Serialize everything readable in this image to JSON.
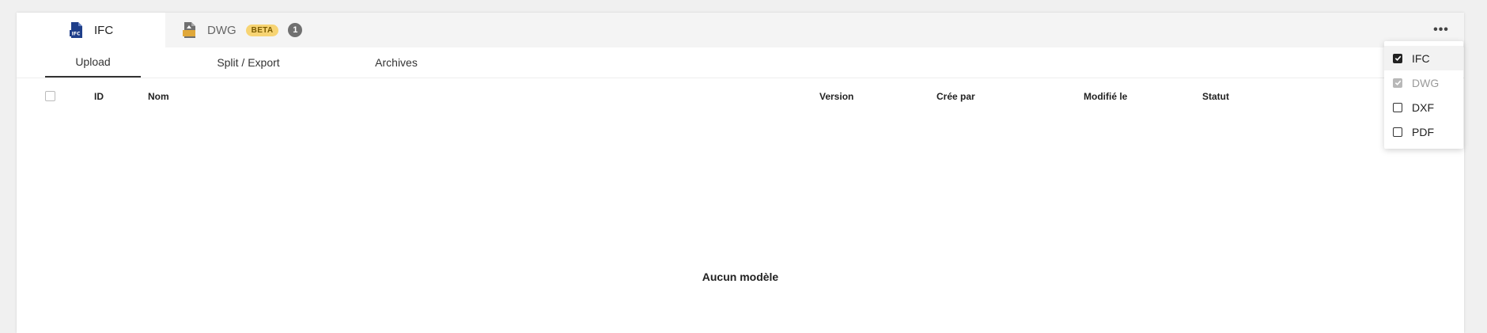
{
  "file_tabs": [
    {
      "label": "IFC",
      "icon": "ifc-file-icon",
      "icon_text": "IFC",
      "active": true
    },
    {
      "label": "DWG",
      "icon": "dwg-file-icon",
      "badge": "BETA",
      "count": "1",
      "active": false
    }
  ],
  "more_menu": {
    "icon": "more-horizontal-icon",
    "label": "•••"
  },
  "subtabs": [
    {
      "label": "Upload",
      "active": true
    },
    {
      "label": "Split / Export",
      "active": false
    },
    {
      "label": "Archives",
      "active": false
    }
  ],
  "table": {
    "columns": {
      "id": "ID",
      "name": "Nom",
      "version": "Version",
      "created_by": "Crée par",
      "modified": "Modifié le",
      "status": "Statut"
    },
    "empty_message": "Aucun modèle"
  },
  "format_menu": {
    "items": [
      {
        "label": "IFC",
        "checked": true,
        "disabled": false
      },
      {
        "label": "DWG",
        "checked": true,
        "disabled": true
      },
      {
        "label": "DXF",
        "checked": false,
        "disabled": false
      },
      {
        "label": "PDF",
        "checked": false,
        "disabled": false
      }
    ]
  },
  "colors": {
    "accent_text": "#222222",
    "beta_badge": "#f7d473",
    "count_badge": "#707070",
    "ifc_icon_blue": "#1f3f8a",
    "dwg_icon_orange": "#e0a83a"
  }
}
